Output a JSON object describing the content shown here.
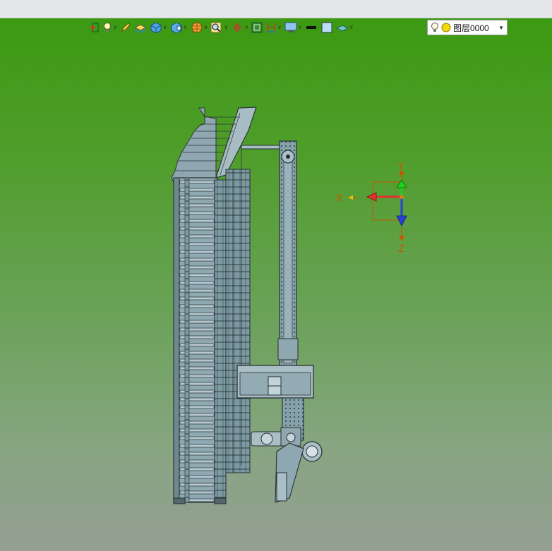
{
  "app": {
    "viewport_background_top": "#3c9a12",
    "viewport_background_bottom": "#959f93"
  },
  "toolbar": {
    "items": [
      {
        "icon": "exit-view-icon",
        "dropdown": false
      },
      {
        "icon": "light-bulb-icon",
        "dropdown": true
      },
      {
        "icon": "pencil-icon",
        "dropdown": false
      },
      {
        "icon": "sheet-stack-icon",
        "dropdown": false
      },
      {
        "icon": "cube-view-icon",
        "dropdown": true
      },
      {
        "icon": "section-cube-icon",
        "dropdown": true
      },
      {
        "icon": "render-ball-icon",
        "dropdown": true
      },
      {
        "icon": "zoom-magnifier-icon",
        "dropdown": true
      },
      {
        "icon": "rotate-pan-icon",
        "dropdown": true
      },
      {
        "icon": "grid-frame-icon",
        "dropdown": false
      },
      {
        "icon": "measure-icon",
        "dropdown": true
      },
      {
        "icon": "display-monitor-icon",
        "dropdown": true
      },
      {
        "icon": "line-color-icon",
        "dropdown": false
      },
      {
        "icon": "fill-color-icon",
        "dropdown": false
      },
      {
        "icon": "layer-plane-icon",
        "dropdown": true
      }
    ],
    "layer_select": {
      "value": "图层0000",
      "bulb_icon": "light-bulb-icon",
      "sun_icon": "yellow-sun-icon"
    }
  },
  "triad": {
    "x_label": "X",
    "y_label": "Y",
    "z_label": "Z"
  }
}
